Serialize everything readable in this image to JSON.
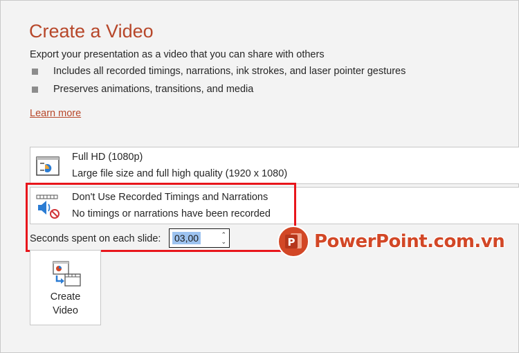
{
  "header": {
    "title": "Create a Video",
    "subtitle": "Export your presentation as a video that you can share with others"
  },
  "bullets": [
    "Includes all recorded timings, narrations, ink strokes, and laser pointer gestures",
    "Preserves animations, transitions, and media"
  ],
  "learn_more": "Learn more",
  "quality_dropdown": {
    "icon": "presentation-quality-icon",
    "title": "Full HD (1080p)",
    "description": "Large file size and full high quality (1920 x 1080)"
  },
  "timings_dropdown": {
    "icon": "speaker-no-narration-icon",
    "title": "Don't Use Recorded Timings and Narrations",
    "description": "No timings or narrations have been recorded"
  },
  "seconds": {
    "label": "Seconds spent on each slide:",
    "value": "03,00"
  },
  "create_button": {
    "icon": "create-video-icon",
    "line1": "Create",
    "line2": "Video"
  },
  "watermark": {
    "logo": "powerpoint-logo-icon",
    "logo_letter": "P",
    "text": "PowerPoint.com.vn"
  },
  "colors": {
    "accent": "#b7472a",
    "highlight_box": "#e8151b",
    "selection": "#9dc3f0"
  }
}
